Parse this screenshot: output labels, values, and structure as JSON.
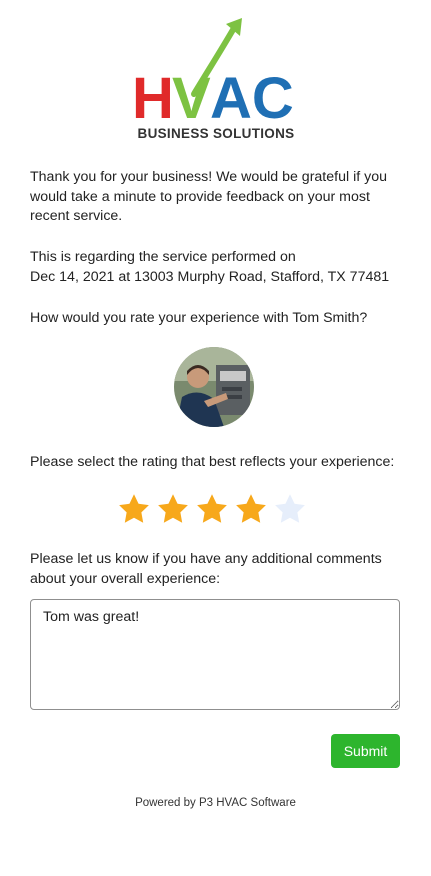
{
  "logo": {
    "wordmark": "HVAC",
    "tagline": "BUSINESS SOLUTIONS",
    "colors": {
      "h": "#e02a2a",
      "v": "#7dc242",
      "ac": "#1f6fb4",
      "tagline": "#333333"
    }
  },
  "intro": "Thank you for your business! We would be grateful if you would take a minute to provide feedback on your most recent service.",
  "service": {
    "line1": "This is regarding the service performed on",
    "line2": "Dec 14, 2021 at 13003 Murphy Road, Stafford, TX 77481"
  },
  "rate_question": "How would you rate your experience with Tom Smith?",
  "rating_prompt": "Please select the rating that best reflects your experience:",
  "rating": {
    "value": 4,
    "max": 5,
    "filled_color": "#f7a81b",
    "empty_color": "#e6eefb"
  },
  "comments": {
    "prompt": "Please let us know if you have any additional comments about your overall experience:",
    "value": "Tom was great!"
  },
  "submit_label": "Submit",
  "footer": "Powered by P3 HVAC Software",
  "colors": {
    "submit_bg": "#2db52d"
  }
}
